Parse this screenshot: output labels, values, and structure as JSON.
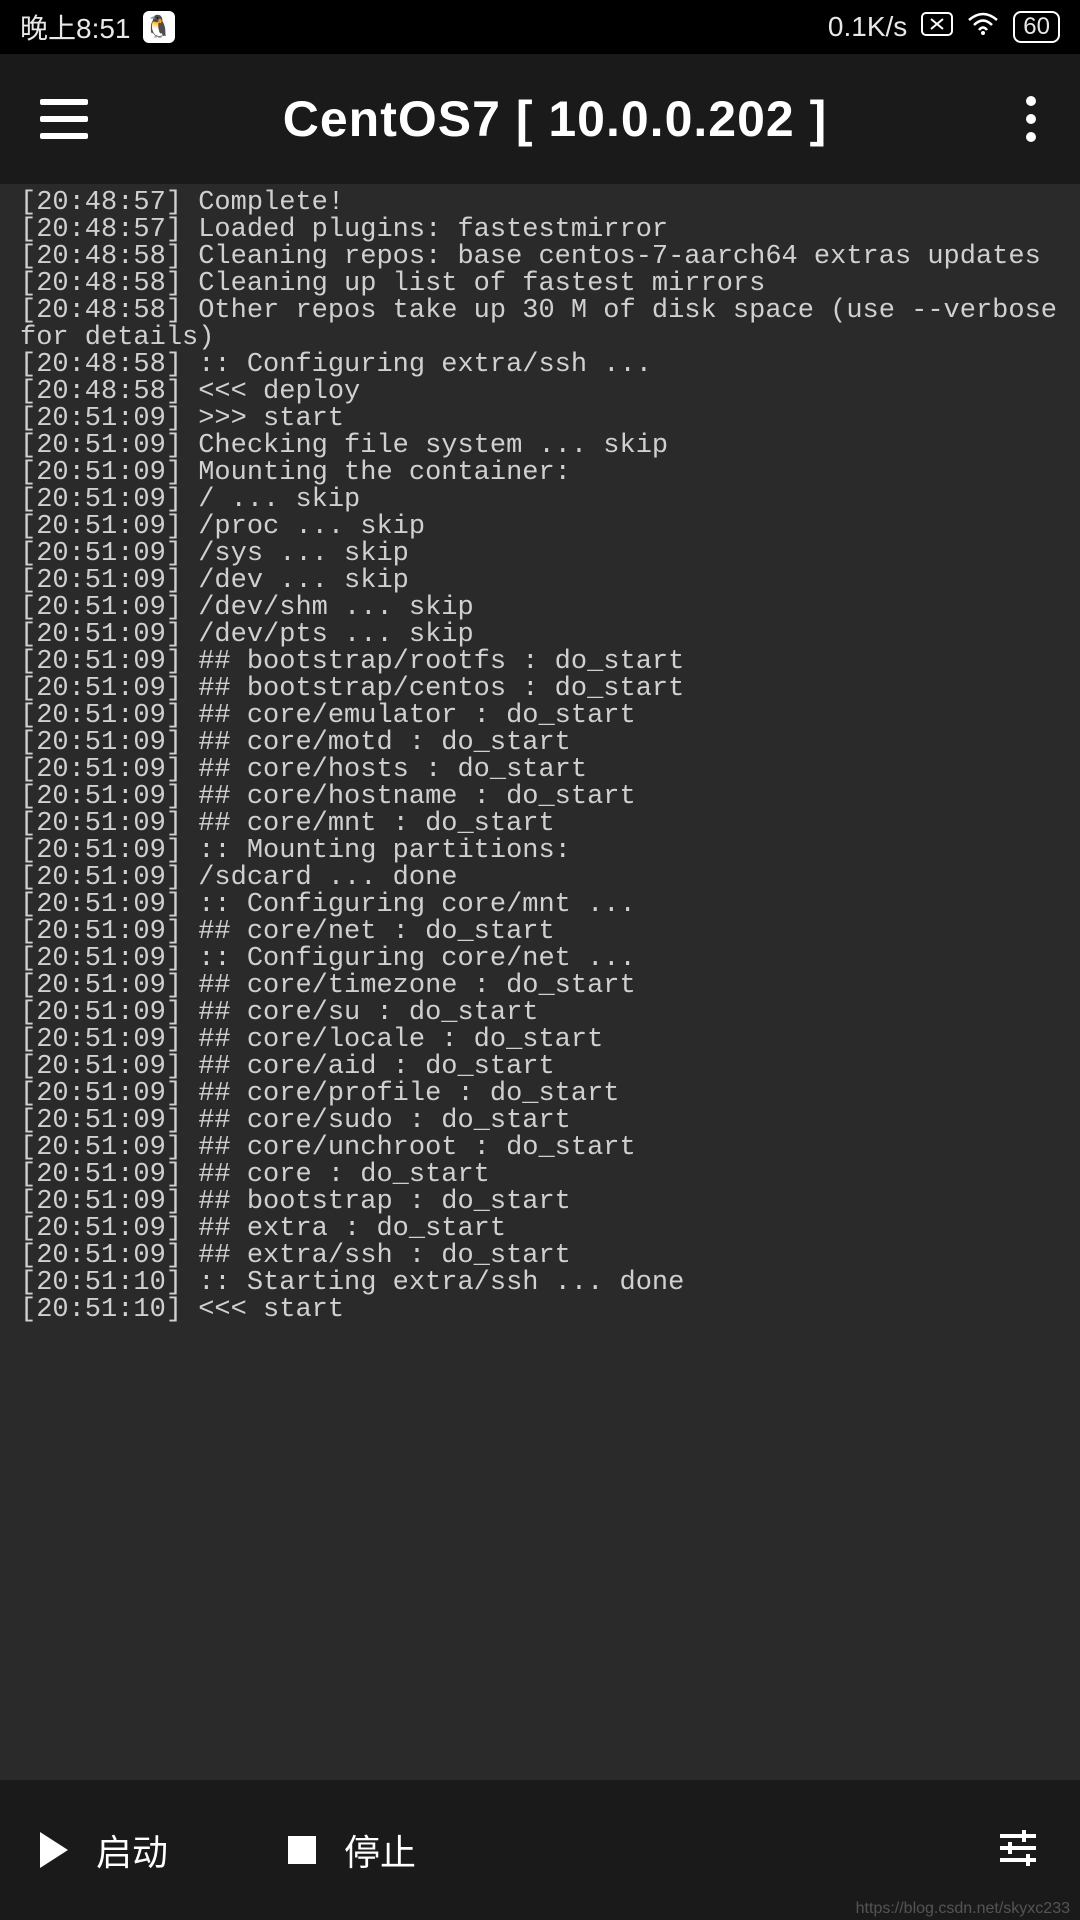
{
  "status_bar": {
    "time": "晚上8:51",
    "net_speed": "0.1K/s",
    "battery": "60"
  },
  "header": {
    "title": "CentOS7  [ 10.0.0.202 ]"
  },
  "terminal": {
    "lines": [
      "[20:48:57] Complete!",
      "[20:48:57] Loaded plugins: fastestmirror",
      "[20:48:58] Cleaning repos: base centos-7-aarch64 extras updates",
      "[20:48:58] Cleaning up list of fastest mirrors",
      "[20:48:58] Other repos take up 30 M of disk space (use --verbose for details)",
      "[20:48:58] :: Configuring extra/ssh ...",
      "[20:48:58] <<< deploy",
      "[20:51:09] >>> start",
      "[20:51:09] Checking file system ... skip",
      "[20:51:09] Mounting the container:",
      "[20:51:09] / ... skip",
      "[20:51:09] /proc ... skip",
      "[20:51:09] /sys ... skip",
      "[20:51:09] /dev ... skip",
      "[20:51:09] /dev/shm ... skip",
      "[20:51:09] /dev/pts ... skip",
      "[20:51:09] ## bootstrap/rootfs : do_start",
      "[20:51:09] ## bootstrap/centos : do_start",
      "[20:51:09] ## core/emulator : do_start",
      "[20:51:09] ## core/motd : do_start",
      "[20:51:09] ## core/hosts : do_start",
      "[20:51:09] ## core/hostname : do_start",
      "[20:51:09] ## core/mnt : do_start",
      "[20:51:09] :: Mounting partitions:",
      "[20:51:09] /sdcard ... done",
      "[20:51:09] :: Configuring core/mnt ...",
      "[20:51:09] ## core/net : do_start",
      "[20:51:09] :: Configuring core/net ...",
      "[20:51:09] ## core/timezone : do_start",
      "[20:51:09] ## core/su : do_start",
      "[20:51:09] ## core/locale : do_start",
      "[20:51:09] ## core/aid : do_start",
      "[20:51:09] ## core/profile : do_start",
      "[20:51:09] ## core/sudo : do_start",
      "[20:51:09] ## core/unchroot : do_start",
      "[20:51:09] ## core : do_start",
      "[20:51:09] ## bootstrap : do_start",
      "[20:51:09] ## extra : do_start",
      "[20:51:09] ## extra/ssh : do_start",
      "[20:51:10] :: Starting extra/ssh ... done",
      "[20:51:10] <<< start"
    ]
  },
  "bottom_bar": {
    "start_label": "启动",
    "stop_label": "停止"
  },
  "watermark": "https://blog.csdn.net/skyxc233"
}
